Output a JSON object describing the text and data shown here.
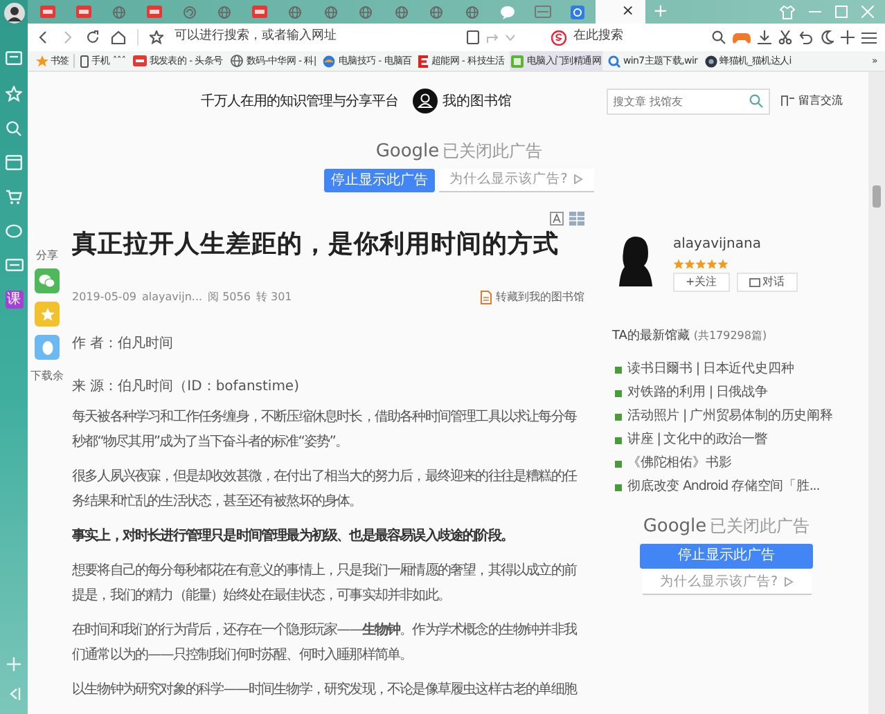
{
  "rail": {
    "tile": "课"
  },
  "tabs": {
    "items": [
      {
        "kind": "red",
        "selected": false
      },
      {
        "kind": "red",
        "selected": false
      },
      {
        "kind": "globe",
        "selected": false
      },
      {
        "kind": "red",
        "selected": false
      },
      {
        "kind": "swirl",
        "selected": false
      },
      {
        "kind": "globe",
        "selected": false
      },
      {
        "kind": "red",
        "selected": false
      },
      {
        "kind": "globe",
        "selected": false
      },
      {
        "kind": "globe",
        "selected": false
      },
      {
        "kind": "globe",
        "selected": false
      },
      {
        "kind": "globe",
        "selected": false
      },
      {
        "kind": "globe",
        "selected": false
      },
      {
        "kind": "globe",
        "selected": false
      },
      {
        "kind": "chat",
        "selected": false
      },
      {
        "kind": "card",
        "selected": false
      },
      {
        "kind": "blue",
        "selected": false
      },
      {
        "selected": true
      }
    ],
    "close": "×",
    "new": "+"
  },
  "address_bar": {
    "placeholder": "可以进行搜索，或者输入网址",
    "search_placeholder": "在此搜索"
  },
  "bookmarks": [
    {
      "kind": "star",
      "label": "书签"
    },
    {
      "kind": "phone",
      "label": "手机 ˆˆˆ"
    },
    {
      "kind": "red",
      "label": "我发表的 - 头条号"
    },
    {
      "kind": "globe",
      "label": "数码-中华网 - 科|"
    },
    {
      "kind": "ball",
      "label": "电脑技巧 - 电脑百"
    },
    {
      "kind": "e",
      "label": "超能网 - 科技生活"
    },
    {
      "kind": "green",
      "label": "电脑入门到精通网"
    },
    {
      "kind": "search",
      "label": "win7主题下载,wir"
    },
    {
      "kind": "dark",
      "label": "蜂猫机_猫机达人i"
    }
  ],
  "bookmarks_more": "»",
  "header": {
    "slogan": "千万人在用的知识管理与分享平台",
    "library": "我的图书馆",
    "search_placeholder": "搜文章 找馆友",
    "message": "留言交流"
  },
  "ad_top": {
    "brand": "Google",
    "closed": "已关闭此广告",
    "stop": "停止显示此广告",
    "why": "为什么显示该广告?"
  },
  "share": {
    "label": "分享",
    "more": "下载余"
  },
  "article": {
    "title": "真正拉开人生差距的，是你利用时间的方式",
    "date": "2019-05-09",
    "author": "alayavijn...",
    "reads": "阅 5056",
    "shares": "转 301",
    "save": "转藏到我的图书馆",
    "byline": "作 者：伯凡时间",
    "source": "来 源：伯凡时间（ID：bofanstime)",
    "paragraphs": [
      {
        "kind": "normal",
        "text": "每天被各种学习和工作任务缠身，不断压缩休息时长，借助各种时间管理工具以求让每分每秒都“物尽其用”成为了当下奋斗者的标准“姿势”。"
      },
      {
        "kind": "normal",
        "text": "很多人夙兴夜寐，但是却收效甚微，在付出了相当大的努力后，最终迎来的往往是糟糕的任务结果和忙乱的生活状态，甚至还有被熬坏的身体。"
      },
      {
        "kind": "bold",
        "text": "事实上，对时长进行管理只是时间管理最为初级、也是最容易误入歧途的阶段。"
      },
      {
        "kind": "normal",
        "text": "想要将自己的每分每秒都花在有意义的事情上，只是我们一厢情愿的奢望，其得以成立的前提是，我们的精力（能量）始终处在最佳状态，可事实却并非如此。"
      },
      {
        "kind": "normal",
        "text": "在时间和我们的行为背后，还存在一个隐形玩家——**生物钟**。作为学术概念的生物钟并非我们通常以为的——只控制我们何时苏醒、何时入睡那样简单。"
      },
      {
        "kind": "normal",
        "text": "以生物钟为研究对象的科学——时间生物学，研究发现，不论是像草履虫这样古老的单细胞"
      }
    ]
  },
  "author": {
    "name": "alayavijnana",
    "stars": 5,
    "follow": "+关注",
    "chat": "对话"
  },
  "latest": {
    "title": "TA的最新馆藏",
    "count": "(共179298篇)",
    "items": [
      "读书日爾书 | 日本近代史四种",
      "对铁路的利用 | 日俄战争",
      "活动照片 | 广州贸易体制的历史阐释",
      "讲座 | 文化中的政治一瞥",
      "《佛陀相佑》书影",
      "彻底改变 Android 存储空间「胜..."
    ]
  },
  "ad_side": {
    "brand": "Google",
    "closed": "已关闭此广告",
    "stop": "停止显示此广告",
    "why": "为什么显示该广告?"
  }
}
